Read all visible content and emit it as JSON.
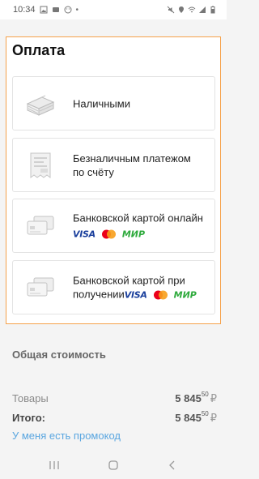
{
  "status_bar": {
    "time": "10:34"
  },
  "sheet": {
    "title": "Оплата",
    "options": [
      {
        "label": "Наличными",
        "icon": "cash-stack-icon",
        "logos": false
      },
      {
        "label": "Безналичным платежом по счёту",
        "icon": "invoice-icon",
        "logos": false
      },
      {
        "label": "Банковской картой онлайн",
        "icon": "bank-card-icon",
        "logos": true
      },
      {
        "label": "Банковской картой при получении",
        "icon": "bank-card-icon",
        "logos": true
      }
    ],
    "logos": {
      "visa": "VISA",
      "mir": "МИР"
    }
  },
  "summary": {
    "title": "Общая стоимость",
    "goods_label": "Товары",
    "goods_value": "5 845",
    "goods_kopeks": "50",
    "total_label": "Итого:",
    "total_value": "5 845",
    "total_kopeks": "50",
    "currency": "₽",
    "promo_link": "У меня есть промокод"
  },
  "colors": {
    "accent_border": "#f5a14a",
    "link": "#5aa6e0",
    "visa": "#1a3f9c",
    "mir": "#2eaa3c"
  }
}
